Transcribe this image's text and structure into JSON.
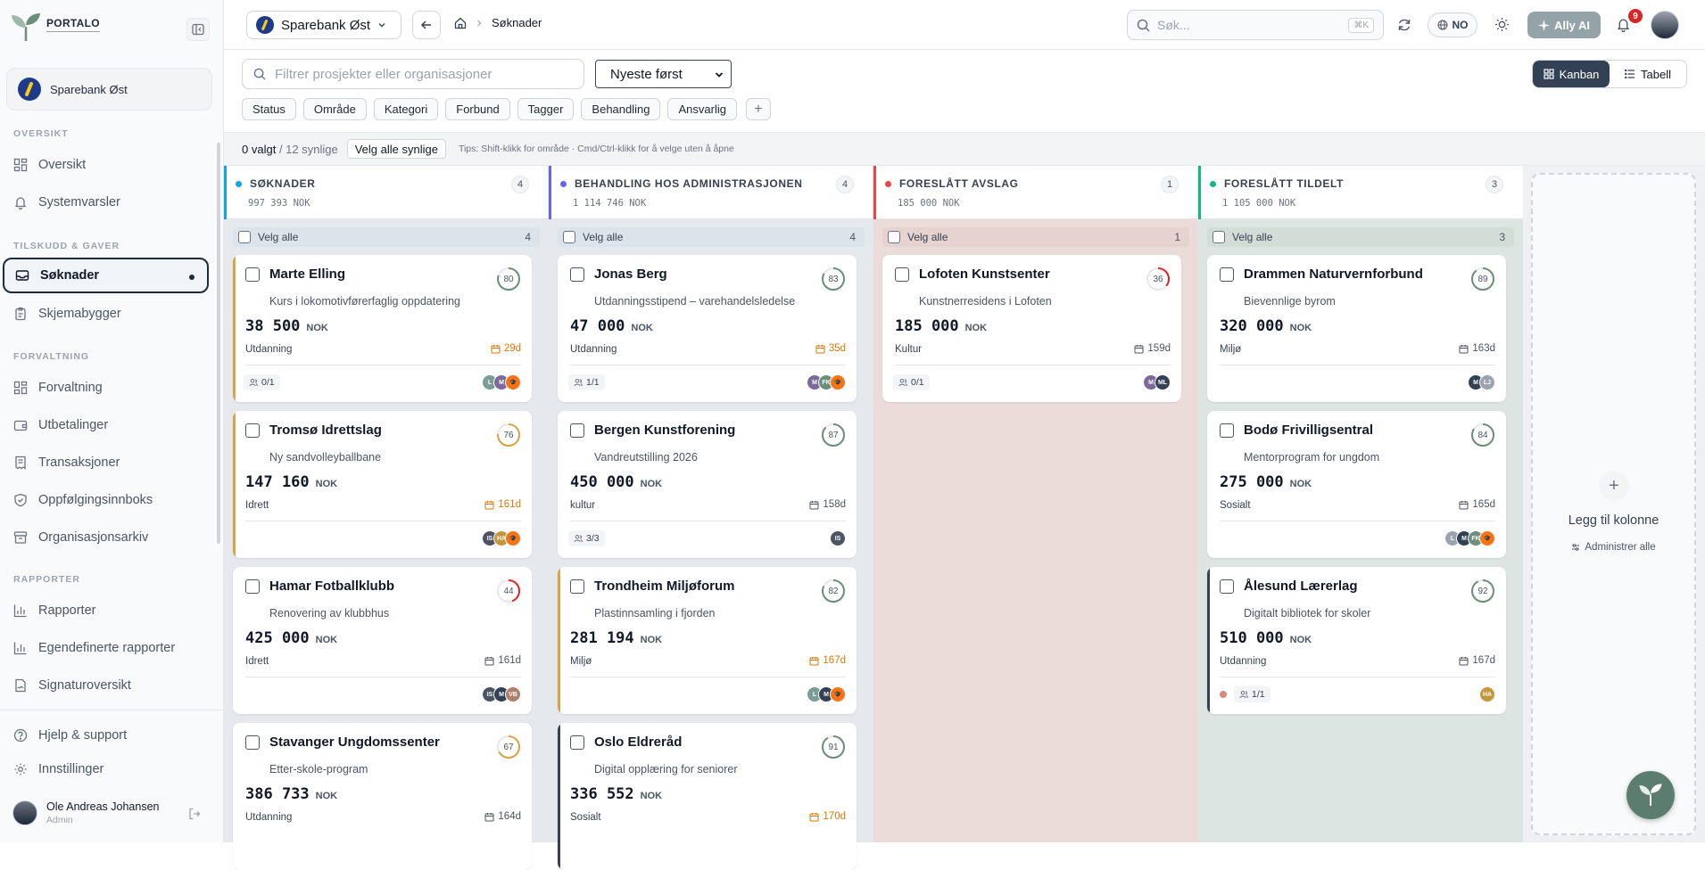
{
  "app": {
    "brand": "PORTALO"
  },
  "sidebar": {
    "org_name": "Sparebank Øst",
    "sections": [
      {
        "title": "OVERSIKT",
        "items": [
          {
            "label": "Oversikt",
            "icon": "grid-icon"
          },
          {
            "label": "Systemvarsler",
            "icon": "bell-icon"
          }
        ]
      },
      {
        "title": "TILSKUDD & GAVER",
        "items": [
          {
            "label": "Søknader",
            "icon": "inbox-icon",
            "active": true
          },
          {
            "label": "Skjemabygger",
            "icon": "clipboard-icon"
          }
        ]
      },
      {
        "title": "FORVALTNING",
        "items": [
          {
            "label": "Forvaltning",
            "icon": "layout-icon"
          },
          {
            "label": "Utbetalinger",
            "icon": "wallet-icon"
          },
          {
            "label": "Transaksjoner",
            "icon": "receipt-icon"
          },
          {
            "label": "Oppfølgingsinnboks",
            "icon": "shield-icon"
          },
          {
            "label": "Organisasjonsarkiv",
            "icon": "archive-icon"
          }
        ]
      },
      {
        "title": "RAPPORTER",
        "items": [
          {
            "label": "Rapporter",
            "icon": "bar-chart-icon"
          },
          {
            "label": "Egendefinerte rapporter",
            "icon": "bar-chart-icon"
          },
          {
            "label": "Signaturoversikt",
            "icon": "signature-icon"
          }
        ]
      }
    ],
    "footer": {
      "help": "Hjelp & support",
      "settings": "Innstillinger",
      "user_name": "Ole Andreas Johansen",
      "user_role": "Admin"
    }
  },
  "topbar": {
    "org_switch": "Sparebank Øst",
    "breadcrumb": "Søknader",
    "search_placeholder": "Søk...",
    "search_shortcut": "⌘K",
    "language": "NO",
    "ai_label": "Ally AI",
    "notification_count": "9"
  },
  "toolbar": {
    "filter_placeholder": "Filtrer prosjekter eller organisasjoner",
    "sort_value": "Nyeste først",
    "view_kanban": "Kanban",
    "view_table": "Tabell",
    "chips": [
      "Status",
      "Område",
      "Kategori",
      "Forbund",
      "Tagger",
      "Behandling",
      "Ansvarlig"
    ]
  },
  "selection": {
    "selected": "0 valgt",
    "visible": "/ 12 synlige",
    "select_all_visible": "Velg alle synlige",
    "tips": "Tips: Shift-klikk for område · Cmd/Ctrl-klikk for å velge uten å åpne"
  },
  "board": {
    "select_all_label": "Velg alle",
    "add_column": "Legg til kolonne",
    "manage_all": "Administrer alle",
    "columns": [
      {
        "title": "SØKNADER",
        "count": "4",
        "total": "997 393 NOK",
        "color": "#0ea5e9",
        "bg": "#e5e9ee",
        "selall_bg": "#dde3ea",
        "cards": [
          {
            "name": "Marte Elling",
            "project": "Kurs i lokomotivførerfaglig oppdatering",
            "amount": "38 500",
            "currency": "NOK",
            "category": "Utdanning",
            "days": "29d",
            "days_warn": true,
            "score": 80,
            "score_color": "#6b8f7a",
            "assign": "0/1",
            "bar": "#d9a441",
            "avatars": [
              {
                "t": "L",
                "c": "#7c9c96"
              },
              {
                "t": "M",
                "c": "#7c6a9c"
              },
              {
                "t": "🎓",
                "c": "#f97316"
              }
            ]
          },
          {
            "name": "Tromsø Idrettslag",
            "project": "Ny sandvolleyballbane",
            "amount": "147 160",
            "currency": "NOK",
            "category": "Idrett",
            "days": "161d",
            "days_warn": true,
            "score": 76,
            "score_color": "#d9a441",
            "assign": "",
            "bar": "#d9a441",
            "avatars": [
              {
                "t": "IS",
                "c": "#4b5563"
              },
              {
                "t": "HA",
                "c": "#c5973a"
              },
              {
                "t": "🎓",
                "c": "#f97316"
              }
            ]
          },
          {
            "name": "Hamar Fotballklubb",
            "project": "Renovering av klubbhus",
            "amount": "425 000",
            "currency": "NOK",
            "category": "Idrett",
            "days": "161d",
            "days_warn": false,
            "score": 44,
            "score_color": "#dc2626",
            "assign": "",
            "bar": "",
            "avatars": [
              {
                "t": "IS",
                "c": "#4b5563"
              },
              {
                "t": "M",
                "c": "#334155"
              },
              {
                "t": "VB",
                "c": "#b07f6a"
              }
            ]
          },
          {
            "name": "Stavanger Ungdomssenter",
            "project": "Etter-skole-program",
            "amount": "386 733",
            "currency": "NOK",
            "category": "Utdanning",
            "days": "164d",
            "days_warn": false,
            "score": 67,
            "score_color": "#d9a441",
            "assign": "",
            "bar": "",
            "avatars": []
          }
        ]
      },
      {
        "title": "BEHANDLING HOS ADMINISTRASJONEN",
        "count": "4",
        "total": "1 114 746 NOK",
        "color": "#6366f1",
        "bg": "#e5e9ee",
        "selall_bg": "#dde3ea",
        "cards": [
          {
            "name": "Jonas Berg",
            "project": "Utdanningsstipend – varehandelsledelse",
            "amount": "47 000",
            "currency": "NOK",
            "category": "Utdanning",
            "days": "35d",
            "days_warn": true,
            "score": 83,
            "score_color": "#6b8f7a",
            "assign": "1/1",
            "bar": "",
            "avatars": [
              {
                "t": "M",
                "c": "#7c6a9c"
              },
              {
                "t": "FK",
                "c": "#6b8f7a"
              },
              {
                "t": "🎓",
                "c": "#f97316"
              }
            ]
          },
          {
            "name": "Bergen Kunstforening",
            "project": "Vandreutstilling 2026",
            "amount": "450 000",
            "currency": "NOK",
            "category": "kultur",
            "days": "158d",
            "days_warn": false,
            "score": 87,
            "score_color": "#6b8f7a",
            "assign": "3/3",
            "bar": "",
            "avatars": [
              {
                "t": "IS",
                "c": "#4b5563"
              }
            ]
          },
          {
            "name": "Trondheim Miljøforum",
            "project": "Plastinnsamling i fjorden",
            "amount": "281 194",
            "currency": "NOK",
            "category": "Miljø",
            "days": "167d",
            "days_warn": true,
            "score": 82,
            "score_color": "#6b8f7a",
            "assign": "",
            "bar": "#d9a441",
            "avatars": [
              {
                "t": "L",
                "c": "#7c9c96"
              },
              {
                "t": "M",
                "c": "#334155"
              },
              {
                "t": "🎓",
                "c": "#f97316"
              }
            ]
          },
          {
            "name": "Oslo Eldreråd",
            "project": "Digital opplæring for seniorer",
            "amount": "336 552",
            "currency": "NOK",
            "category": "Sosialt",
            "days": "170d",
            "days_warn": true,
            "score": 91,
            "score_color": "#6b8f7a",
            "assign": "",
            "bar": "#334155",
            "avatars": []
          }
        ]
      },
      {
        "title": "FORESLÅTT AVSLAG",
        "count": "1",
        "total": "185 000 NOK",
        "color": "#ef4444",
        "bg": "#ecdcd9",
        "selall_bg": "#e6d2ce",
        "cards": [
          {
            "name": "Lofoten Kunstsenter",
            "project": "Kunstnerresidens i Lofoten",
            "amount": "185 000",
            "currency": "NOK",
            "category": "Kultur",
            "days": "159d",
            "days_warn": false,
            "score": 36,
            "score_color": "#dc2626",
            "assign": "0/1",
            "bar": "",
            "avatars": [
              {
                "t": "M",
                "c": "#7c6a9c"
              },
              {
                "t": "ML",
                "c": "#334155"
              }
            ]
          }
        ]
      },
      {
        "title": "FORESLÅTT TILDELT",
        "count": "3",
        "total": "1 105 000 NOK",
        "color": "#10b981",
        "bg": "#dce5e1",
        "selall_bg": "#d3ddd8",
        "cards": [
          {
            "name": "Drammen Naturvernforbund",
            "project": "Bievennlige byrom",
            "amount": "320 000",
            "currency": "NOK",
            "category": "Miljø",
            "days": "163d",
            "days_warn": false,
            "score": 89,
            "score_color": "#6b8f7a",
            "assign": "",
            "bar": "",
            "avatars": [
              {
                "t": "M",
                "c": "#334155"
              },
              {
                "t": "LJ",
                "c": "#9ca3af"
              }
            ]
          },
          {
            "name": "Bodø Frivilligsentral",
            "project": "Mentorprogram for ungdom",
            "amount": "275 000",
            "currency": "NOK",
            "category": "Sosialt",
            "days": "165d",
            "days_warn": false,
            "score": 84,
            "score_color": "#6b8f7a",
            "assign": "",
            "bar": "",
            "avatars": [
              {
                "t": "L",
                "c": "#9ca3af"
              },
              {
                "t": "M",
                "c": "#334155"
              },
              {
                "t": "FK",
                "c": "#6b8f7a"
              },
              {
                "t": "🎓",
                "c": "#f97316"
              }
            ]
          },
          {
            "name": "Ålesund Lærerlag",
            "project": "Digitalt bibliotek for skoler",
            "amount": "510 000",
            "currency": "NOK",
            "category": "Utdanning",
            "days": "167d",
            "days_warn": false,
            "score": 92,
            "score_color": "#6b8f7a",
            "assign": "1/1",
            "reddot": true,
            "bar": "#334155",
            "avatars": [
              {
                "t": "HA",
                "c": "#c5973a"
              }
            ]
          }
        ]
      }
    ]
  }
}
